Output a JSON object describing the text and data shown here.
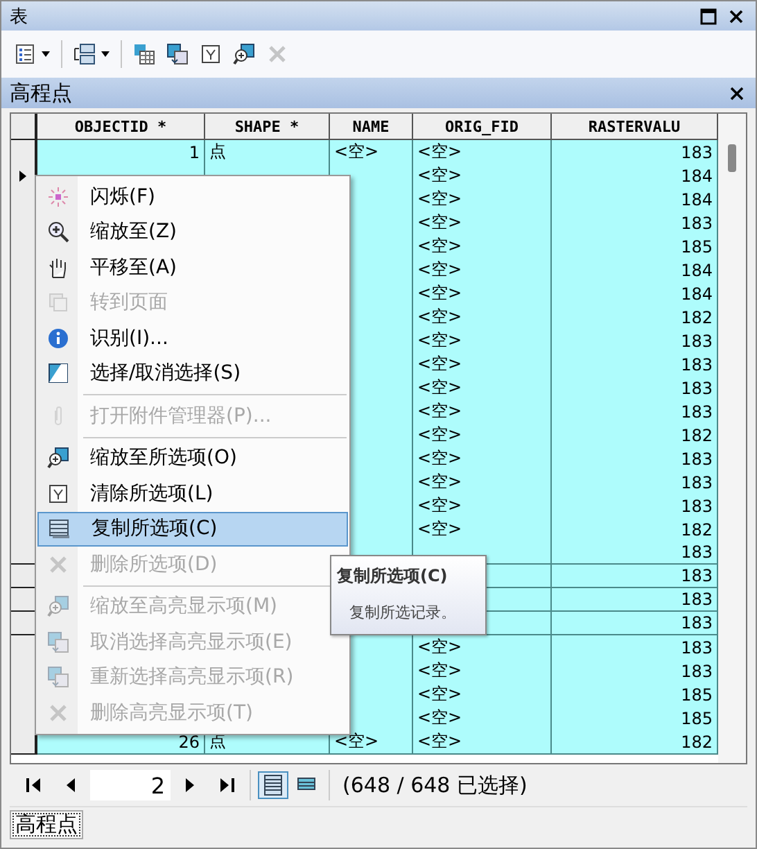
{
  "window": {
    "title": "表"
  },
  "toolbar": {
    "buttons": [
      {
        "kind": "options",
        "dropdown": true,
        "disabled": false
      },
      {
        "kind": "related",
        "dropdown": true,
        "disabled": false
      },
      {
        "kind": "select-attr",
        "dropdown": false,
        "disabled": false
      },
      {
        "kind": "switch",
        "dropdown": false,
        "disabled": false
      },
      {
        "kind": "clear",
        "dropdown": false,
        "disabled": false
      },
      {
        "kind": "zoom-selected",
        "dropdown": false,
        "disabled": false
      },
      {
        "kind": "delete",
        "dropdown": false,
        "disabled": true
      }
    ]
  },
  "table_window": {
    "title": "高程点",
    "columns": [
      "OBJECTID *",
      "SHAPE *",
      "NAME",
      "ORIG_FID",
      "RASTERVALU"
    ],
    "rows": [
      {
        "selected": true,
        "current": false,
        "objectid": "1",
        "shape": "点",
        "name": "<空>",
        "orig_fid": "<空>",
        "rastervalu": "183"
      },
      {
        "selected": true,
        "current": true,
        "orig_fid": "<空>",
        "rastervalu": "184"
      },
      {
        "selected": true,
        "current": false,
        "orig_fid": "<空>",
        "rastervalu": "184"
      },
      {
        "selected": true,
        "current": false,
        "orig_fid": "<空>",
        "rastervalu": "183"
      },
      {
        "selected": true,
        "current": false,
        "orig_fid": "<空>",
        "rastervalu": "185"
      },
      {
        "selected": true,
        "current": false,
        "orig_fid": "<空>",
        "rastervalu": "184"
      },
      {
        "selected": true,
        "current": false,
        "orig_fid": "<空>",
        "rastervalu": "184"
      },
      {
        "selected": true,
        "current": false,
        "orig_fid": "<空>",
        "rastervalu": "182"
      },
      {
        "selected": true,
        "current": false,
        "orig_fid": "<空>",
        "rastervalu": "183"
      },
      {
        "selected": true,
        "current": false,
        "orig_fid": "<空>",
        "rastervalu": "183"
      },
      {
        "selected": true,
        "current": false,
        "orig_fid": "<空>",
        "rastervalu": "183"
      },
      {
        "selected": true,
        "current": false,
        "orig_fid": "<空>",
        "rastervalu": "183"
      },
      {
        "selected": true,
        "current": false,
        "orig_fid": "<空>",
        "rastervalu": "182"
      },
      {
        "selected": true,
        "current": false,
        "orig_fid": "<空>",
        "rastervalu": "183"
      },
      {
        "selected": true,
        "current": false,
        "orig_fid": "<空>",
        "rastervalu": "183"
      },
      {
        "selected": true,
        "current": false,
        "orig_fid": "<空>",
        "rastervalu": "183"
      },
      {
        "selected": true,
        "current": false,
        "orig_fid": "<空>",
        "rastervalu": "182"
      },
      {
        "selected": true,
        "current": false,
        "rastervalu": "183"
      },
      {
        "selected": true,
        "current": false,
        "rastervalu": "183"
      },
      {
        "selected": true,
        "current": false,
        "rastervalu": "183"
      },
      {
        "selected": true,
        "current": false,
        "rastervalu": "183"
      },
      {
        "selected": true,
        "current": false,
        "orig_fid": "<空>",
        "rastervalu": "183"
      },
      {
        "selected": true,
        "current": false,
        "orig_fid": "<空>",
        "rastervalu": "183"
      },
      {
        "selected": true,
        "current": false,
        "orig_fid": "<空>",
        "rastervalu": "185"
      },
      {
        "selected": true,
        "current": false,
        "orig_fid": "<空>",
        "rastervalu": "185"
      },
      {
        "selected": true,
        "current": false,
        "objectid": "26",
        "shape": "点",
        "name": "<空>",
        "orig_fid": "<空>",
        "rastervalu": "182"
      }
    ]
  },
  "context_menu": {
    "items": [
      {
        "kind": "flash",
        "label": "闪烁(F)",
        "disabled": false,
        "selected": false
      },
      {
        "kind": "zoom",
        "label": "缩放至(Z)",
        "disabled": false,
        "selected": false
      },
      {
        "kind": "pan",
        "label": "平移至(A)",
        "disabled": false,
        "selected": false
      },
      {
        "kind": "goto",
        "label": "转到页面",
        "disabled": true,
        "selected": false
      },
      {
        "kind": "identify",
        "label": "识别(I)...",
        "disabled": false,
        "selected": false
      },
      {
        "kind": "select",
        "label": "选择/取消选择(S)",
        "disabled": false,
        "selected": false
      },
      {
        "kind": "separator"
      },
      {
        "kind": "attach",
        "label": "打开附件管理器(P)...",
        "disabled": true,
        "selected": false
      },
      {
        "kind": "separator"
      },
      {
        "kind": "zoom-selected",
        "label": "缩放至所选项(O)",
        "disabled": false,
        "selected": false
      },
      {
        "kind": "clear",
        "label": "清除所选项(L)",
        "disabled": false,
        "selected": false
      },
      {
        "kind": "copy",
        "label": "复制所选项(C)",
        "disabled": false,
        "selected": true
      },
      {
        "kind": "delete",
        "label": "删除所选项(D)",
        "disabled": true,
        "selected": false
      },
      {
        "kind": "separator"
      },
      {
        "kind": "zoom-selected",
        "label": "缩放至高亮显示项(M)",
        "disabled": true,
        "selected": false
      },
      {
        "kind": "switch",
        "label": "取消选择高亮显示项(E)",
        "disabled": true,
        "selected": false
      },
      {
        "kind": "switch",
        "label": "重新选择高亮显示项(R)",
        "disabled": true,
        "selected": false
      },
      {
        "kind": "delete",
        "label": "删除高亮显示项(T)",
        "disabled": true,
        "selected": false
      }
    ]
  },
  "tooltip": {
    "title": "复制所选项(C)",
    "text": "复制所选记录。"
  },
  "navigator": {
    "page": "2",
    "views": [
      {
        "kind": "all",
        "selected": true
      },
      {
        "kind": "selected",
        "selected": false
      }
    ],
    "status": "(648 / 648 已选择)"
  },
  "tabs": [
    {
      "label": "高程点",
      "selected": true
    }
  ]
}
